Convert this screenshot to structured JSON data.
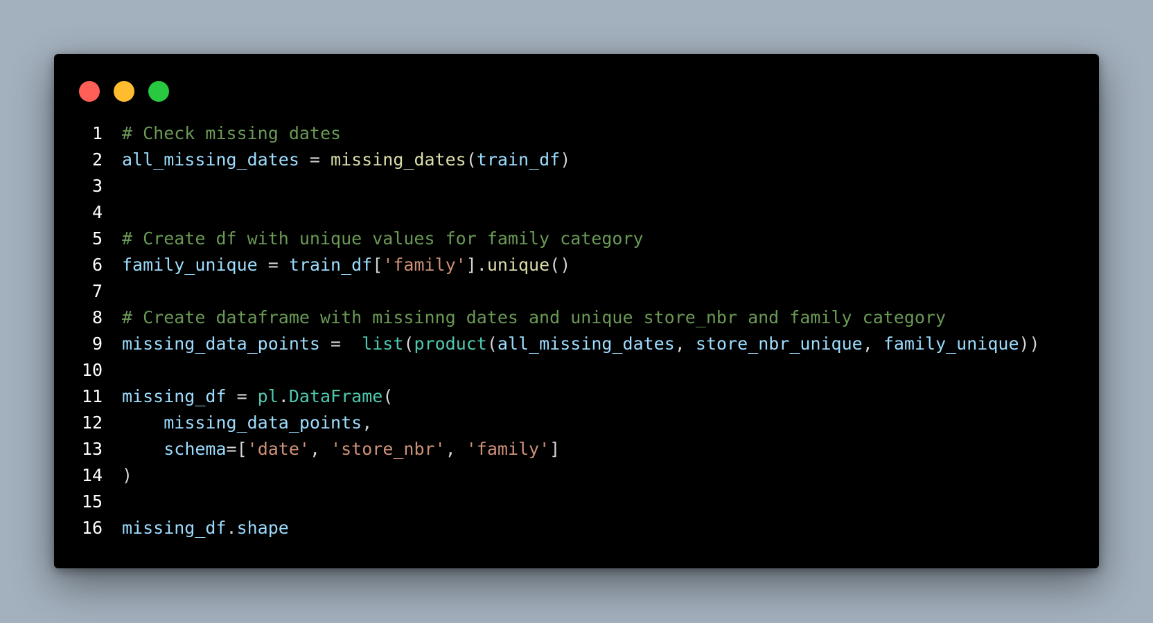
{
  "colors": {
    "background": "#a3b0bd",
    "window": "#000000",
    "close_light": "#ff5f57",
    "minimize_light": "#febc2e",
    "zoom_light": "#28c840"
  },
  "window_controls": [
    "close",
    "minimize",
    "zoom"
  ],
  "code": {
    "language": "python",
    "lines": [
      {
        "n": "1",
        "tokens": [
          {
            "t": "# Check missing dates",
            "c": "comment"
          }
        ]
      },
      {
        "n": "2",
        "tokens": [
          {
            "t": "all_missing_dates",
            "c": "var"
          },
          {
            "t": " = ",
            "c": "op"
          },
          {
            "t": "missing_dates",
            "c": "fn"
          },
          {
            "t": "(",
            "c": "op"
          },
          {
            "t": "train_df",
            "c": "var"
          },
          {
            "t": ")",
            "c": "op"
          }
        ]
      },
      {
        "n": "3",
        "tokens": []
      },
      {
        "n": "4",
        "tokens": []
      },
      {
        "n": "5",
        "tokens": [
          {
            "t": "# Create df with unique values for family category",
            "c": "comment"
          }
        ]
      },
      {
        "n": "6",
        "tokens": [
          {
            "t": "family_unique",
            "c": "var"
          },
          {
            "t": " = ",
            "c": "op"
          },
          {
            "t": "train_df",
            "c": "var"
          },
          {
            "t": "[",
            "c": "op"
          },
          {
            "t": "'family'",
            "c": "str"
          },
          {
            "t": "].",
            "c": "op"
          },
          {
            "t": "unique",
            "c": "fn"
          },
          {
            "t": "()",
            "c": "op"
          }
        ]
      },
      {
        "n": "7",
        "tokens": []
      },
      {
        "n": "8",
        "tokens": [
          {
            "t": "# Create dataframe with missinng dates and unique store_nbr and family category",
            "c": "comment"
          }
        ]
      },
      {
        "n": "9",
        "tokens": [
          {
            "t": "missing_data_points",
            "c": "var"
          },
          {
            "t": " =  ",
            "c": "op"
          },
          {
            "t": "list",
            "c": "builtin"
          },
          {
            "t": "(",
            "c": "op"
          },
          {
            "t": "product",
            "c": "builtin"
          },
          {
            "t": "(",
            "c": "op"
          },
          {
            "t": "all_missing_dates",
            "c": "var"
          },
          {
            "t": ", ",
            "c": "op"
          },
          {
            "t": "store_nbr_unique",
            "c": "var"
          },
          {
            "t": ", ",
            "c": "op"
          },
          {
            "t": "family_unique",
            "c": "var"
          },
          {
            "t": "))",
            "c": "op"
          }
        ]
      },
      {
        "n": "10",
        "tokens": []
      },
      {
        "n": "11",
        "tokens": [
          {
            "t": "missing_df",
            "c": "var"
          },
          {
            "t": " = ",
            "c": "op"
          },
          {
            "t": "pl",
            "c": "builtin"
          },
          {
            "t": ".",
            "c": "op"
          },
          {
            "t": "DataFrame",
            "c": "builtin"
          },
          {
            "t": "(",
            "c": "op"
          }
        ]
      },
      {
        "n": "12",
        "tokens": [
          {
            "t": "    ",
            "c": "op"
          },
          {
            "t": "missing_data_points",
            "c": "var"
          },
          {
            "t": ",",
            "c": "op"
          }
        ]
      },
      {
        "n": "13",
        "tokens": [
          {
            "t": "    ",
            "c": "op"
          },
          {
            "t": "schema",
            "c": "var"
          },
          {
            "t": "=[",
            "c": "op"
          },
          {
            "t": "'date'",
            "c": "str"
          },
          {
            "t": ", ",
            "c": "op"
          },
          {
            "t": "'store_nbr'",
            "c": "str"
          },
          {
            "t": ", ",
            "c": "op"
          },
          {
            "t": "'family'",
            "c": "str"
          },
          {
            "t": "]",
            "c": "op"
          }
        ]
      },
      {
        "n": "14",
        "tokens": [
          {
            "t": ")",
            "c": "op"
          }
        ]
      },
      {
        "n": "15",
        "tokens": []
      },
      {
        "n": "16",
        "tokens": [
          {
            "t": "missing_df",
            "c": "var"
          },
          {
            "t": ".",
            "c": "op"
          },
          {
            "t": "shape",
            "c": "var"
          }
        ]
      }
    ]
  }
}
